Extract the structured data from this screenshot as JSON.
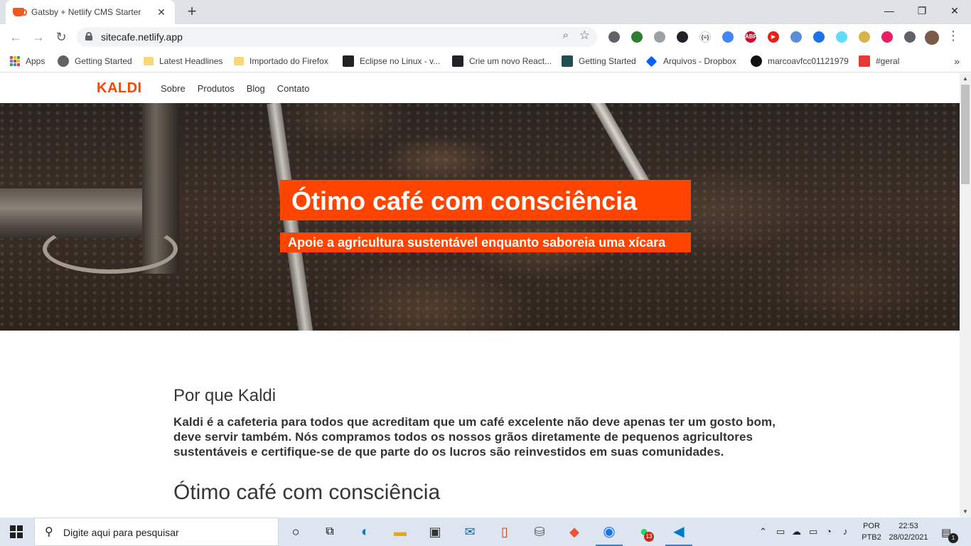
{
  "browser": {
    "tab_title": "Gatsby + Netlify CMS Starter",
    "tab_close": "✕",
    "new_tab": "+",
    "window_controls": {
      "minimize": "—",
      "maximize": "❐",
      "close": "✕"
    },
    "url": "sitecafe.netlify.app",
    "back": "←",
    "forward": "→",
    "reload": "↻",
    "zoom_icon": "⌕",
    "star_icon": "☆",
    "menu": "⋮",
    "bookmarks": [
      {
        "label": "Apps",
        "icon": "apps-grid-icon"
      },
      {
        "label": "Getting Started",
        "icon": "globe-icon"
      },
      {
        "label": "Latest Headlines",
        "icon": "folder-icon"
      },
      {
        "label": "Importado do Firefox",
        "icon": "folder-icon"
      },
      {
        "label": "Eclipse no Linux - v...",
        "icon": "linux-icon"
      },
      {
        "label": "Crie um novo React...",
        "icon": "react-icon"
      },
      {
        "label": "Getting Started",
        "icon": "react-icon"
      },
      {
        "label": "Arquivos - Dropbox",
        "icon": "dropbox-icon"
      },
      {
        "label": "marcoavfcc01121979",
        "icon": "github-icon"
      },
      {
        "label": "#geral",
        "icon": "calendar-icon"
      }
    ],
    "bookmarks_more": "»",
    "extensions": [
      {
        "name": "settings-ext-icon",
        "color": "#5f6368",
        "text": ""
      },
      {
        "name": "globe-ext-icon",
        "color": "#2e7d32",
        "text": ""
      },
      {
        "name": "timer-ext-icon",
        "color": "#9aa0a6",
        "text": ""
      },
      {
        "name": "react-devtools-icon",
        "color": "#20232a",
        "text": ""
      },
      {
        "name": "json-ext-icon",
        "color": "#ffffff",
        "text": "{≡}"
      },
      {
        "name": "ext-blue-icon",
        "color": "#4285f4",
        "text": ""
      },
      {
        "name": "adblock-plus-icon",
        "color": "#c70d2c",
        "text": "ABP"
      },
      {
        "name": "youtube-ext-icon",
        "color": "#e62117",
        "text": "▶"
      },
      {
        "name": "ext-blue2-icon",
        "color": "#5b8ed8",
        "text": ""
      },
      {
        "name": "ext-blue3-icon",
        "color": "#1a73e8",
        "text": ""
      },
      {
        "name": "react-ext-icon",
        "color": "#61dafb",
        "text": ""
      },
      {
        "name": "ext-gold-icon",
        "color": "#d8b24a",
        "text": ""
      },
      {
        "name": "ext-colors-icon",
        "color": "#e91e63",
        "text": ""
      },
      {
        "name": "puzzle-icon",
        "color": "#5f6368",
        "text": ""
      }
    ]
  },
  "site": {
    "logo": "KALDI",
    "nav": [
      "Sobre",
      "Produtos",
      "Blog",
      "Contato"
    ],
    "hero_title": "Ótimo café com consciência",
    "hero_subtitle": "Apoie a agricultura sustentável enquanto saboreia uma xícara",
    "section_heading": "Por que Kaldi",
    "section_text": "Kaldi é a cafeteria para todos que acreditam que um café excelente não deve apenas ter um gosto bom, deve servir também. Nós compramos todos os nossos grãos diretamente de pequenos agricultores sustentáveis e certifique-se de que parte do os lucros são reinvestidos em suas comunidades.",
    "next_heading": "Ótimo café com consciência",
    "accent_color": "#ff4400"
  },
  "taskbar": {
    "search_placeholder": "Digite aqui para pesquisar",
    "apps": [
      "cortana-icon",
      "task-view-icon",
      "edge-icon",
      "file-explorer-icon",
      "store-icon",
      "mail-icon",
      "office-icon",
      "installer-icon",
      "git-icon",
      "chrome-icon",
      "whatsapp-icon",
      "vscode-icon"
    ],
    "whatsapp_badge": "13",
    "lang_line1": "POR",
    "lang_line2": "PTB2",
    "time": "22:53",
    "date": "28/02/2021",
    "notifications": "1"
  }
}
